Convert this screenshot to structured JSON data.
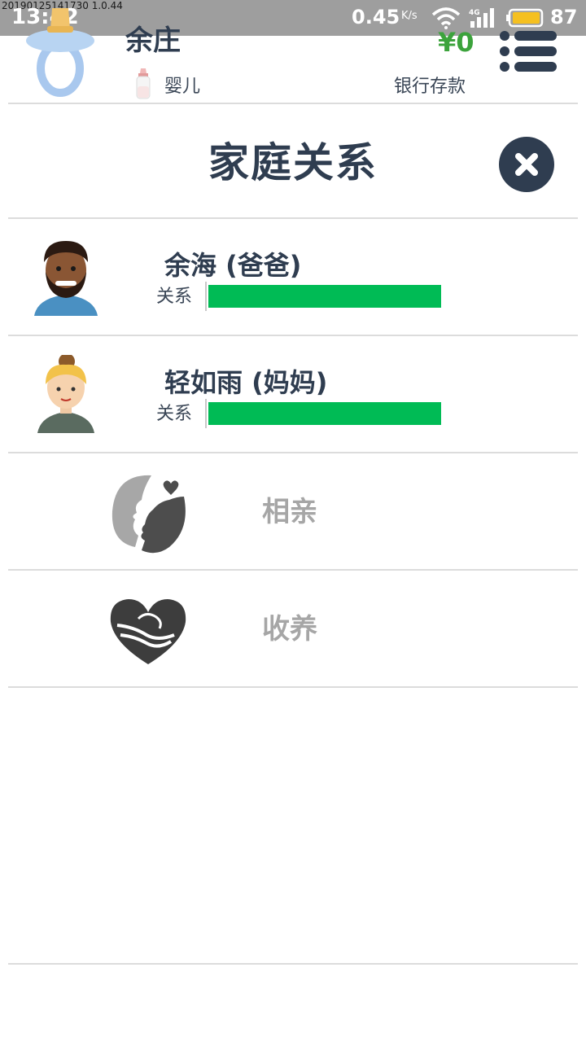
{
  "status_bar": {
    "build_tag": "20190125141730 1.0.44",
    "time": "13:42",
    "net_speed": "0.45",
    "net_unit": "K/s",
    "battery": "87"
  },
  "header": {
    "name": "余庄",
    "life_stage": "婴儿",
    "money": "¥0",
    "bank_label": "银行存款",
    "avatar_icon": "pacifier-icon",
    "stage_icon": "baby-bottle-icon",
    "menu_icon": "menu-icon"
  },
  "dialog": {
    "title": "家庭关系",
    "close_icon": "close-icon"
  },
  "family": [
    {
      "name": "余海 (爸爸)",
      "relation_label": "关系",
      "relation_level": 1.0,
      "avatar": "father-avatar"
    },
    {
      "name": "轻如雨 (妈妈)",
      "relation_label": "关系",
      "relation_level": 1.0,
      "avatar": "mother-avatar"
    }
  ],
  "actions": [
    {
      "label": "相亲",
      "icon": "dating-icon"
    },
    {
      "label": "收养",
      "icon": "adopt-heart-icon"
    }
  ],
  "colors": {
    "primary": "#2f3d50",
    "money": "#3ca33c",
    "relation_bar": "#00bb55",
    "muted_label": "#a6a6a6"
  }
}
